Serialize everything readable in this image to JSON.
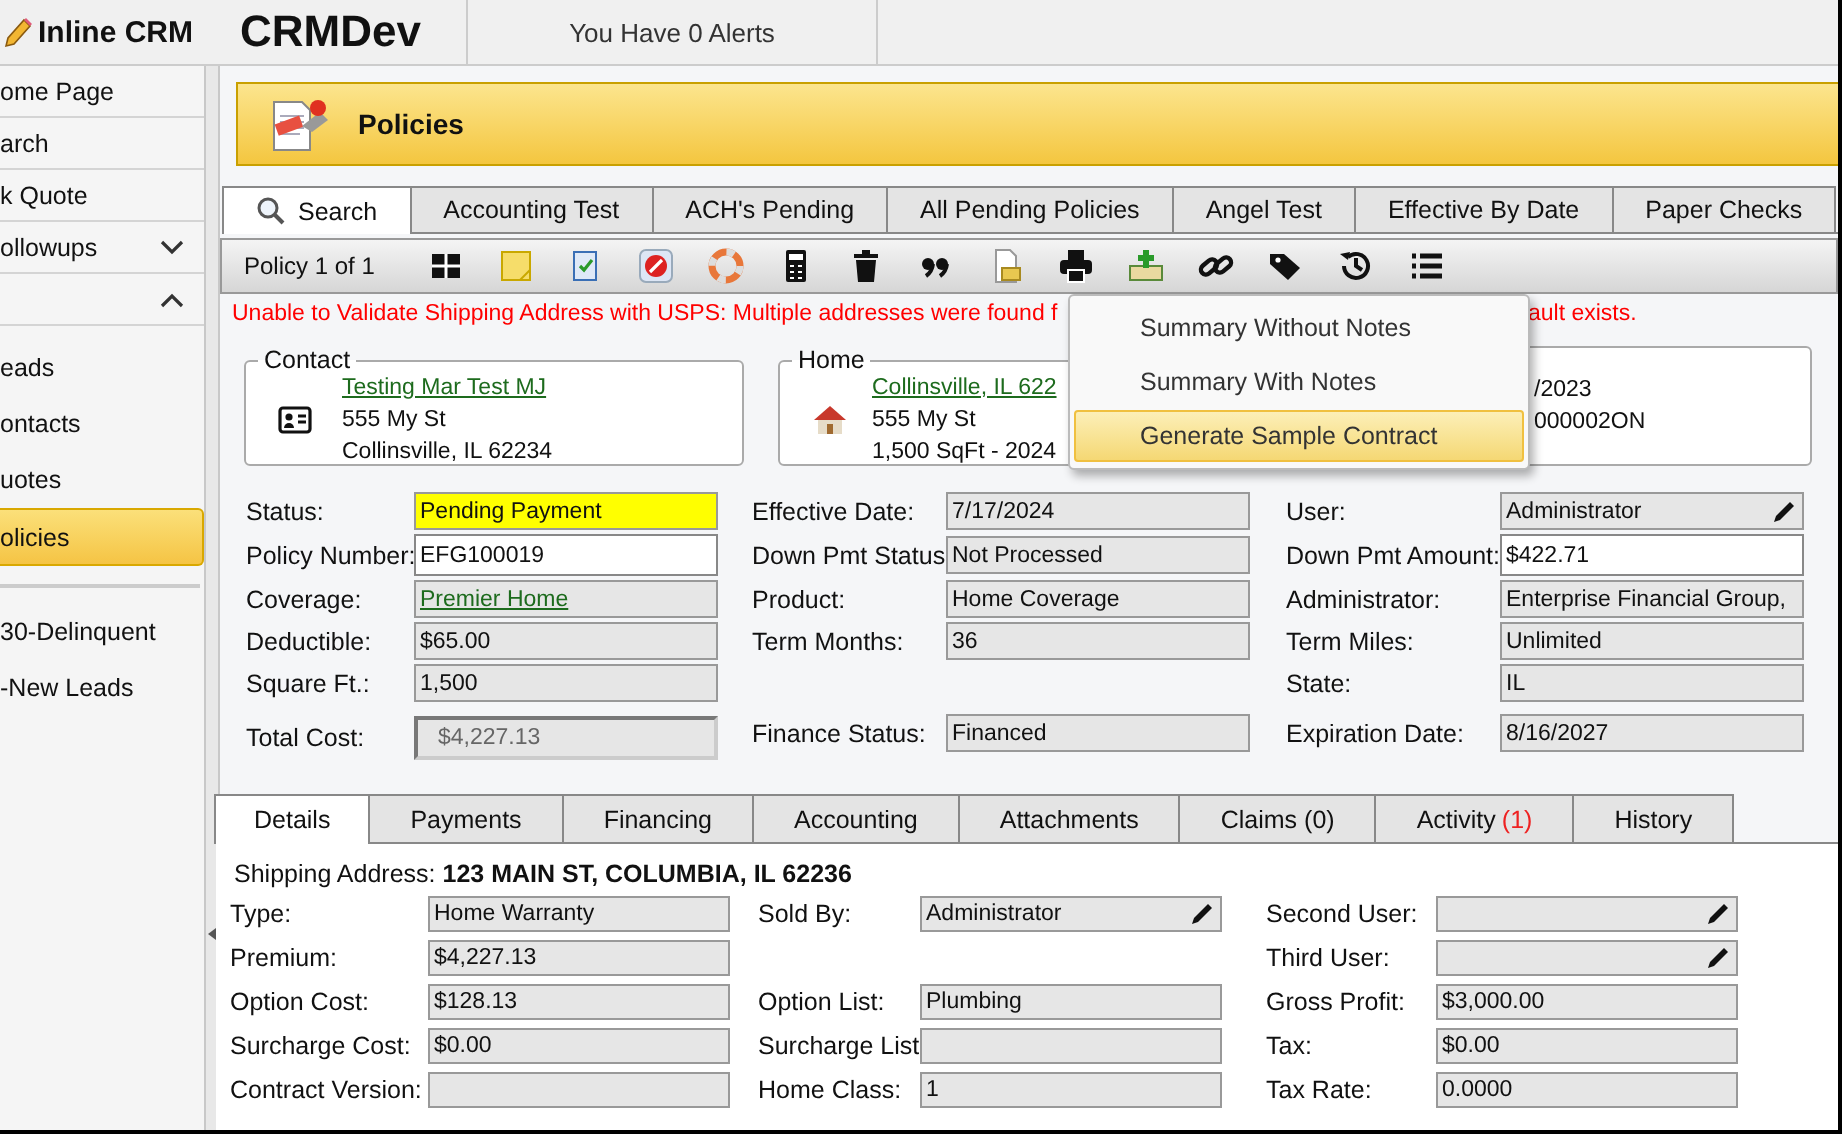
{
  "app": {
    "name": "Inline CRM",
    "environment": "CRMDev",
    "alerts": "You Have 0 Alerts"
  },
  "sidebar": {
    "items": [
      {
        "kind": "link",
        "label": "ome Page",
        "selected": false
      },
      {
        "kind": "link",
        "label": "arch",
        "selected": false
      },
      {
        "kind": "link",
        "label": "k Quote",
        "selected": false
      },
      {
        "kind": "group",
        "label": "ollowups",
        "expanded": false
      },
      {
        "kind": "group",
        "expanded": true,
        "children": [
          {
            "label": "eads",
            "selected": false
          },
          {
            "label": "ontacts",
            "selected": false
          },
          {
            "label": "uotes",
            "selected": false
          },
          {
            "label": "olicies",
            "selected": true
          }
        ]
      }
    ],
    "lists": [
      {
        "label": "30-Delinquent",
        "selected": false
      },
      {
        "label": "-New Leads",
        "selected": false
      }
    ]
  },
  "page": {
    "title": "Policies"
  },
  "search_tabs": [
    {
      "kind": "search",
      "label": "Search",
      "selected": true
    },
    {
      "kind": "saved",
      "label": "Accounting Test",
      "selected": false
    },
    {
      "kind": "saved",
      "label": "ACH's Pending",
      "selected": false
    },
    {
      "kind": "saved",
      "label": "All Pending Policies",
      "selected": false
    },
    {
      "kind": "saved",
      "label": "Angel Test",
      "selected": false
    },
    {
      "kind": "saved",
      "label": "Effective By Date",
      "selected": false
    },
    {
      "kind": "saved",
      "label": "Paper Checks",
      "selected": false
    }
  ],
  "toolbar": {
    "record": "Policy 1 of 1"
  },
  "error": {
    "start": "Unable to Validate Shipping Address with USPS: Multiple addresses were found f",
    "end": "ault exists."
  },
  "print_menu": {
    "items": [
      {
        "label": "Summary Without Notes",
        "selected": false
      },
      {
        "label": "Summary With Notes",
        "selected": false
      },
      {
        "label": "Generate Sample Contract",
        "selected": true
      }
    ]
  },
  "cards": [
    {
      "kind": "contact",
      "legend": "Contact",
      "link": "Testing Mar Test MJ",
      "lines": [
        "555 My St",
        "Collinsville, IL 62234"
      ]
    },
    {
      "kind": "home",
      "legend": "Home",
      "link": "Collinsville, IL 622",
      "lines": [
        "555 My St",
        "1,500 SqFt - 2024"
      ]
    },
    {
      "kind": "covered",
      "lines": [
        "/2023",
        "000002ON"
      ]
    }
  ],
  "policy_fields": {
    "rows": [
      [
        {
          "kind": "status",
          "label": "Status:",
          "value": "Pending Payment"
        },
        {
          "kind": "readonly",
          "label": "Effective Date:",
          "value": "7/17/2024"
        },
        {
          "kind": "picker",
          "label": "User:",
          "value": "Administrator"
        }
      ],
      [
        {
          "kind": "input",
          "label": "Policy Number:",
          "value": "EFG100019"
        },
        {
          "kind": "readonly",
          "label": "Down Pmt Status:",
          "value": "Not Processed"
        },
        {
          "kind": "input",
          "label": "Down Pmt Amount:",
          "value": "$422.71"
        }
      ],
      [
        {
          "kind": "link",
          "label": "Coverage:",
          "value": "Premier Home"
        },
        {
          "kind": "readonly",
          "label": "Product:",
          "value": "Home Coverage"
        },
        {
          "kind": "readonly",
          "label": "Administrator:",
          "value": "Enterprise Financial Group,"
        }
      ],
      [
        {
          "kind": "readonly",
          "label": "Deductible:",
          "value": "$65.00"
        },
        {
          "kind": "readonly",
          "label": "Term Months:",
          "value": "36"
        },
        {
          "kind": "readonly",
          "label": "Term Miles:",
          "value": "Unlimited"
        }
      ],
      [
        {
          "kind": "readonly",
          "label": "Square Ft.:",
          "value": "1,500"
        },
        {
          "kind": "blank"
        },
        {
          "kind": "readonly",
          "label": "State:",
          "value": "IL"
        }
      ],
      [
        {
          "kind": "disabled",
          "label": "Total Cost:",
          "value": "$4,227.13"
        },
        {
          "kind": "readonly",
          "label": "Finance Status:",
          "value": "Financed"
        },
        {
          "kind": "readonly",
          "label": "Expiration Date:",
          "value": "8/16/2027"
        }
      ]
    ]
  },
  "detail_tabs": [
    {
      "label": "Details",
      "selected": true
    },
    {
      "label": "Payments",
      "selected": false
    },
    {
      "label": "Financing",
      "selected": false
    },
    {
      "label": "Accounting",
      "selected": false
    },
    {
      "label": "Attachments",
      "selected": false
    },
    {
      "label": "Claims (0)",
      "selected": false
    },
    {
      "label": "Activity",
      "badge": "(1)",
      "selected": false
    },
    {
      "label": "History",
      "selected": false
    }
  ],
  "shipping": {
    "label": "Shipping Address:",
    "value": "123 MAIN ST, COLUMBIA, IL 62236"
  },
  "detail_fields": {
    "rows": [
      [
        {
          "kind": "readonly",
          "label": "Type:",
          "value": "Home Warranty"
        },
        {
          "kind": "picker",
          "label": "Sold By:",
          "value": "Administrator"
        },
        {
          "kind": "picker",
          "label": "Second User:"
        }
      ],
      [
        {
          "kind": "readonly",
          "label": "Premium:",
          "value": "$4,227.13"
        },
        {
          "kind": "blank"
        },
        {
          "kind": "picker",
          "label": "Third User:"
        }
      ],
      [
        {
          "kind": "readonly",
          "label": "Option Cost:",
          "value": "$128.13"
        },
        {
          "kind": "readonly",
          "label": "Option List:",
          "value": "Plumbing"
        },
        {
          "kind": "readonly",
          "label": "Gross Profit:",
          "value": "$3,000.00"
        }
      ],
      [
        {
          "kind": "readonly",
          "label": "Surcharge Cost:",
          "value": "$0.00"
        },
        {
          "kind": "readonly",
          "label": "Surcharge List:"
        },
        {
          "kind": "readonly",
          "label": "Tax:",
          "value": "$0.00"
        }
      ],
      [
        {
          "kind": "readonly",
          "label": "Contract Version:"
        },
        {
          "kind": "readonly",
          "label": "Home Class:",
          "value": "1"
        },
        {
          "kind": "readonly",
          "label": "Tax Rate:",
          "value": "0.0000"
        }
      ]
    ]
  }
}
